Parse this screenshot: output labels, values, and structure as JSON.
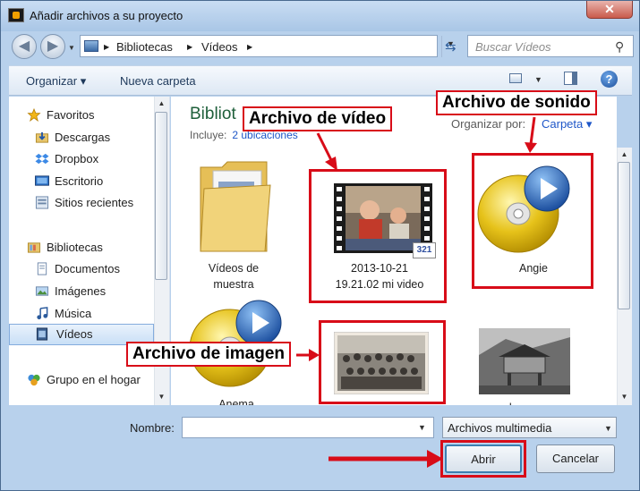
{
  "window": {
    "title": "Añadir archivos a su proyecto",
    "close_label": "✕"
  },
  "address": {
    "breadcrumbs": [
      "Bibliotecas",
      "Vídeos"
    ],
    "separator": "▶",
    "search_placeholder": "Buscar Vídeos"
  },
  "toolbar": {
    "organize": "Organizar ▾",
    "new_folder": "Nueva carpeta",
    "help": "?"
  },
  "sidebar": {
    "favorites": "Favoritos",
    "items": [
      "Descargas",
      "Dropbox",
      "Escritorio",
      "Sitios recientes"
    ],
    "libraries": "Bibliotecas",
    "library_items": [
      "Documentos",
      "Imágenes",
      "Música",
      "Vídeos"
    ],
    "homegroup": "Grupo en el hogar"
  },
  "main": {
    "library_title": "Bibliot",
    "includes_label": "Incluye:",
    "includes_link": "2 ubicaciones",
    "arrange_label": "Organizar por:",
    "arrange_value": "Carpeta ▾",
    "files": [
      {
        "name_line1": "Vídeos de",
        "name_line2": "muestra"
      },
      {
        "name_line1": "2013-10-21",
        "name_line2": "19.21.02 mi video",
        "badge": "321"
      },
      {
        "name_line1": "Angie",
        "name_line2": ""
      },
      {
        "name_line1": "Anema",
        "name_line2": ""
      },
      {
        "name_line1": "",
        "name_line2": ""
      },
      {
        "name_line1": "horreo",
        "name_line2": ""
      }
    ]
  },
  "annotations": {
    "video": "Archivo de vídeo",
    "sound": "Archivo de sonido",
    "image": "Archivo de imagen"
  },
  "bottom": {
    "name_label": "Nombre:",
    "name_value": "",
    "file_type": "Archivos multimedia",
    "open_button": "Abrir",
    "cancel_button": "Cancelar"
  },
  "colors": {
    "annotation_red": "#d80c18",
    "link_blue": "#1e56c8",
    "library_green": "#1e5f3a"
  }
}
